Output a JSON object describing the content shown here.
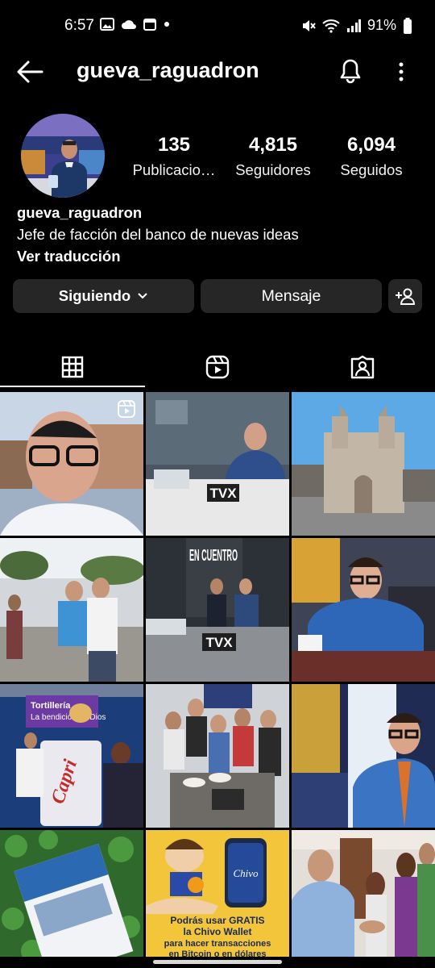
{
  "status_bar": {
    "time": "6:57",
    "battery": "91%"
  },
  "header": {
    "username": "gueva_raguadron"
  },
  "stats": [
    {
      "number": "135",
      "label": "Publicacio…"
    },
    {
      "number": "4,815",
      "label": "Seguidores"
    },
    {
      "number": "6,094",
      "label": "Seguidos"
    }
  ],
  "bio": {
    "name": "gueva_raguadron",
    "text": "Jefe de facción del banco de nuevas ideas",
    "translate": "Ver traducción"
  },
  "buttons": {
    "following": "Siguiendo",
    "message": "Mensaje"
  },
  "tabs": [
    {
      "icon": "grid-icon",
      "selected": true
    },
    {
      "icon": "reels-icon",
      "selected": false
    },
    {
      "icon": "tagged-icon",
      "selected": false
    }
  ],
  "posts": [
    {
      "kind": "reel-selfie-street"
    },
    {
      "kind": "tv-studio-interview",
      "logo": "TVX"
    },
    {
      "kind": "cathedral-street"
    },
    {
      "kind": "street-photo-group"
    },
    {
      "kind": "tv-studio-encuentro",
      "sign": "EN CUENTRO",
      "logo": "TVX"
    },
    {
      "kind": "blue-suit-portrait"
    },
    {
      "kind": "tortilleria-stand",
      "sign_line1": "Tortillería",
      "sign_line2": "La bendición de Dios",
      "box_text": "Capri"
    },
    {
      "kind": "group-with-food"
    },
    {
      "kind": "portrait-with-flag"
    },
    {
      "kind": "book-on-clover"
    },
    {
      "kind": "chivo-wallet-ad",
      "wallet": "Chivo",
      "caption1": "Podrás usar GRATIS",
      "caption2": "la Chivo Wallet",
      "caption3": "para hacer transacciones",
      "caption4": "en Bitcoin o en dólares"
    },
    {
      "kind": "handshake-meeting"
    }
  ]
}
